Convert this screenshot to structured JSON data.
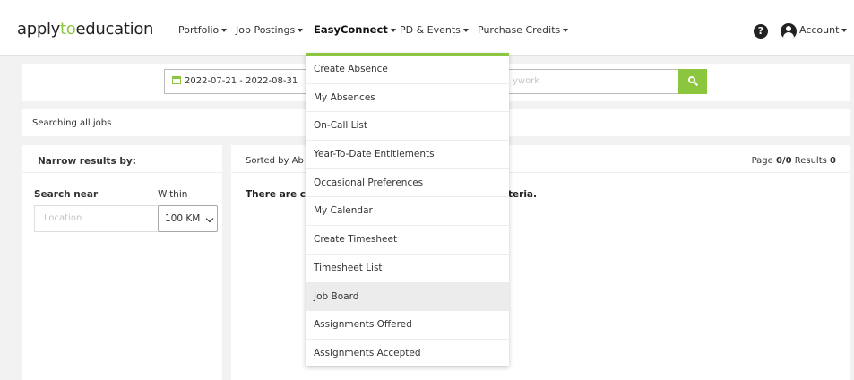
{
  "nav": {
    "logo_pre": "apply",
    "logo_to": "to",
    "logo_post": "education",
    "items": [
      "Portfolio",
      "Job Postings",
      "EasyConnect",
      "PD & Events",
      "Purchase Credits"
    ],
    "help": "?",
    "account": "Account"
  },
  "search": {
    "date_range": "2022-07-21 - 2022-08-31",
    "keyword_placeholder": "ywork"
  },
  "status": {
    "searching": "Searching all jobs"
  },
  "filters": {
    "title": "Narrow results by:",
    "search_near": "Search near",
    "within": "Within",
    "location_placeholder": "Location",
    "distance": "100 KM"
  },
  "results": {
    "sorted_by": "Sorted by Ab",
    "page_label": "Page",
    "page_value": "0/0",
    "results_label": "Results",
    "results_value": "0",
    "empty_head": "There are cu",
    "empty_tail": "teria."
  },
  "dropdown": {
    "items": [
      "Create Absence",
      "My Absences",
      "On-Call List",
      "Year-To-Date Entitlements",
      "Occasional Preferences",
      "My Calendar",
      "Create Timesheet",
      "Timesheet List",
      "Job Board",
      "Assignments Offered",
      "Assignments Accepted"
    ],
    "hovered_index": 8
  },
  "colors": {
    "accent": "#8cc63f",
    "background": "#f2f2f2"
  }
}
